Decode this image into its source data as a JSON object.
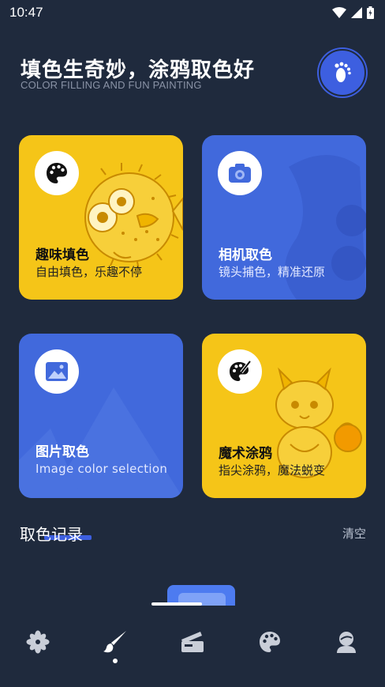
{
  "status_bar": {
    "time": "10:47"
  },
  "header": {
    "title": "填色生奇妙，涂鸦取色好",
    "subtitle": "COLOR FILLING AND FUN PAINTING"
  },
  "cards": [
    {
      "title": "趣味填色",
      "subtitle": "自由填色，乐趣不停"
    },
    {
      "title": "相机取色",
      "subtitle": "镜头捕色，精准还原"
    },
    {
      "title": "图片取色",
      "subtitle": "Image color selection"
    },
    {
      "title": "魔术涂鸦",
      "subtitle": "指尖涂鸦，魔法蜕变"
    }
  ],
  "history": {
    "title": "取色记录",
    "clear_label": "清空"
  },
  "colors": {
    "background": "#1f2a3d",
    "yellow_card": "#f5c518",
    "blue_card": "#4169dc",
    "accent": "#3d5fe0"
  },
  "bottom_nav": [
    {
      "icon": "pinwheel-icon"
    },
    {
      "icon": "brush-icon",
      "active": true
    },
    {
      "icon": "clapperboard-icon"
    },
    {
      "icon": "palette-icon"
    },
    {
      "icon": "profile-icon"
    }
  ]
}
